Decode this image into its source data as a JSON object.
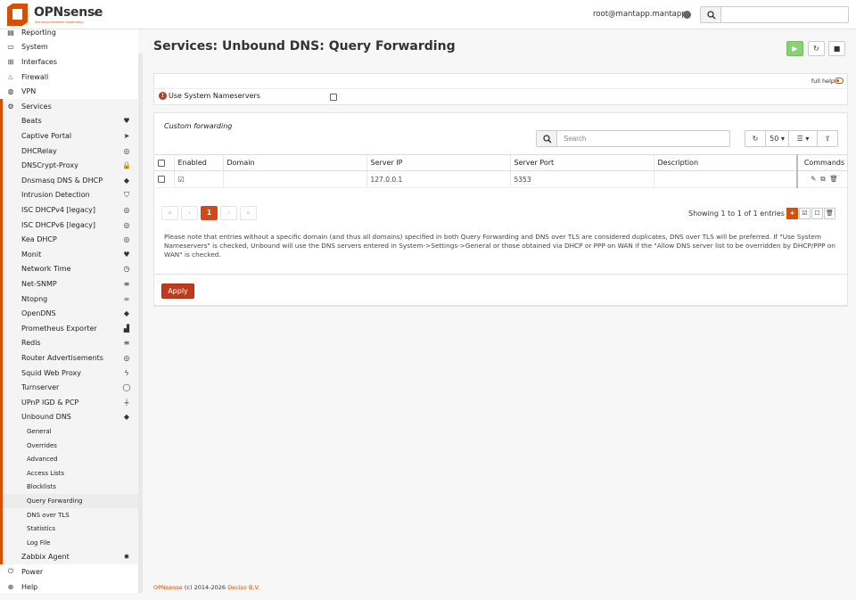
{
  "brand": {
    "name": "OPNsense",
    "tagline": "Securing networks made easy",
    "accent": "#d94f00"
  },
  "topbar": {
    "user": "root@mantapp.mantapp",
    "search_placeholder": ""
  },
  "sidebar": {
    "items": [
      {
        "label": "Reporting",
        "icon": "chart-icon"
      },
      {
        "label": "System",
        "icon": "server-icon"
      },
      {
        "label": "Interfaces",
        "icon": "sitemap-icon"
      },
      {
        "label": "Firewall",
        "icon": "flame-icon"
      },
      {
        "label": "VPN",
        "icon": "globe-icon"
      },
      {
        "label": "Services",
        "icon": "gear-icon"
      }
    ],
    "services": [
      {
        "label": "Beats",
        "icon": "heartbeat-icon"
      },
      {
        "label": "Captive Portal",
        "icon": "paper-plane-icon"
      },
      {
        "label": "DHCRelay",
        "icon": "target-icon"
      },
      {
        "label": "DNSCrypt-Proxy",
        "icon": "lock-icon"
      },
      {
        "label": "Dnsmasq DNS & DHCP",
        "icon": "tags-icon"
      },
      {
        "label": "Intrusion Detection",
        "icon": "shield-icon"
      },
      {
        "label": "ISC DHCPv4 [legacy]",
        "icon": "target-icon"
      },
      {
        "label": "ISC DHCPv6 [legacy]",
        "icon": "target-icon"
      },
      {
        "label": "Kea DHCP",
        "icon": "target-icon"
      },
      {
        "label": "Monit",
        "icon": "heartbeat-icon"
      },
      {
        "label": "Network Time",
        "icon": "clock-icon"
      },
      {
        "label": "Net-SNMP",
        "icon": "database-icon"
      },
      {
        "label": "Ntopng",
        "icon": "binoculars-icon"
      },
      {
        "label": "OpenDNS",
        "icon": "tags-icon"
      },
      {
        "label": "Prometheus Exporter",
        "icon": "area-chart-icon"
      },
      {
        "label": "Redis",
        "icon": "database-icon"
      },
      {
        "label": "Router Advertisements",
        "icon": "target-icon"
      },
      {
        "label": "Squid Web Proxy",
        "icon": "bolt-icon"
      },
      {
        "label": "Turnserver",
        "icon": "comment-icon"
      },
      {
        "label": "UPnP IGD & PCP",
        "icon": "plug-icon"
      },
      {
        "label": "Unbound DNS",
        "icon": "tags-icon"
      }
    ],
    "unbound_sub": [
      "General",
      "Overrides",
      "Advanced",
      "Access Lists",
      "Blocklists",
      "Query Forwarding",
      "DNS over TLS",
      "Statistics",
      "Log File"
    ],
    "after": [
      {
        "label": "Zabbix Agent",
        "icon": "cog-icon"
      },
      {
        "label": "Power",
        "icon": "power-icon"
      },
      {
        "label": "Help",
        "icon": "lifebuoy-icon"
      }
    ]
  },
  "page": {
    "title": "Services: Unbound DNS: Query Forwarding"
  },
  "settings": {
    "full_help": "full help",
    "use_system_ns": "Use System Nameservers"
  },
  "grid": {
    "title": "Custom forwarding",
    "search_placeholder": "Search",
    "page_size": "50",
    "columns": [
      "Enabled",
      "Domain",
      "Server IP",
      "Server Port",
      "Description",
      "Commands"
    ],
    "rows": [
      {
        "enabled": true,
        "domain": "",
        "server_ip": "127.0.0.1",
        "server_port": "5353",
        "description": ""
      }
    ],
    "pager": {
      "first": "«",
      "prev": "‹",
      "current": "1",
      "next": "›",
      "last": "»"
    },
    "showing": "Showing 1 to 1 of 1 entries"
  },
  "note": "Please note that entries without a specific domain (and thus all domains) specified in both Query Forwarding and DNS over TLS are considered duplicates, DNS over TLS will be preferred. If \"Use System Nameservers\" is checked, Unbound will use the DNS servers entered in System->Settings->General or those obtained via DHCP or PPP on WAN if the \"Allow DNS server list to be overridden by DHCP/PPP on WAN\" is checked.",
  "apply_label": "Apply",
  "footer": {
    "brand": "OPNsense",
    "copyright": "(c) 2014-2026",
    "company": "Deciso B.V."
  }
}
